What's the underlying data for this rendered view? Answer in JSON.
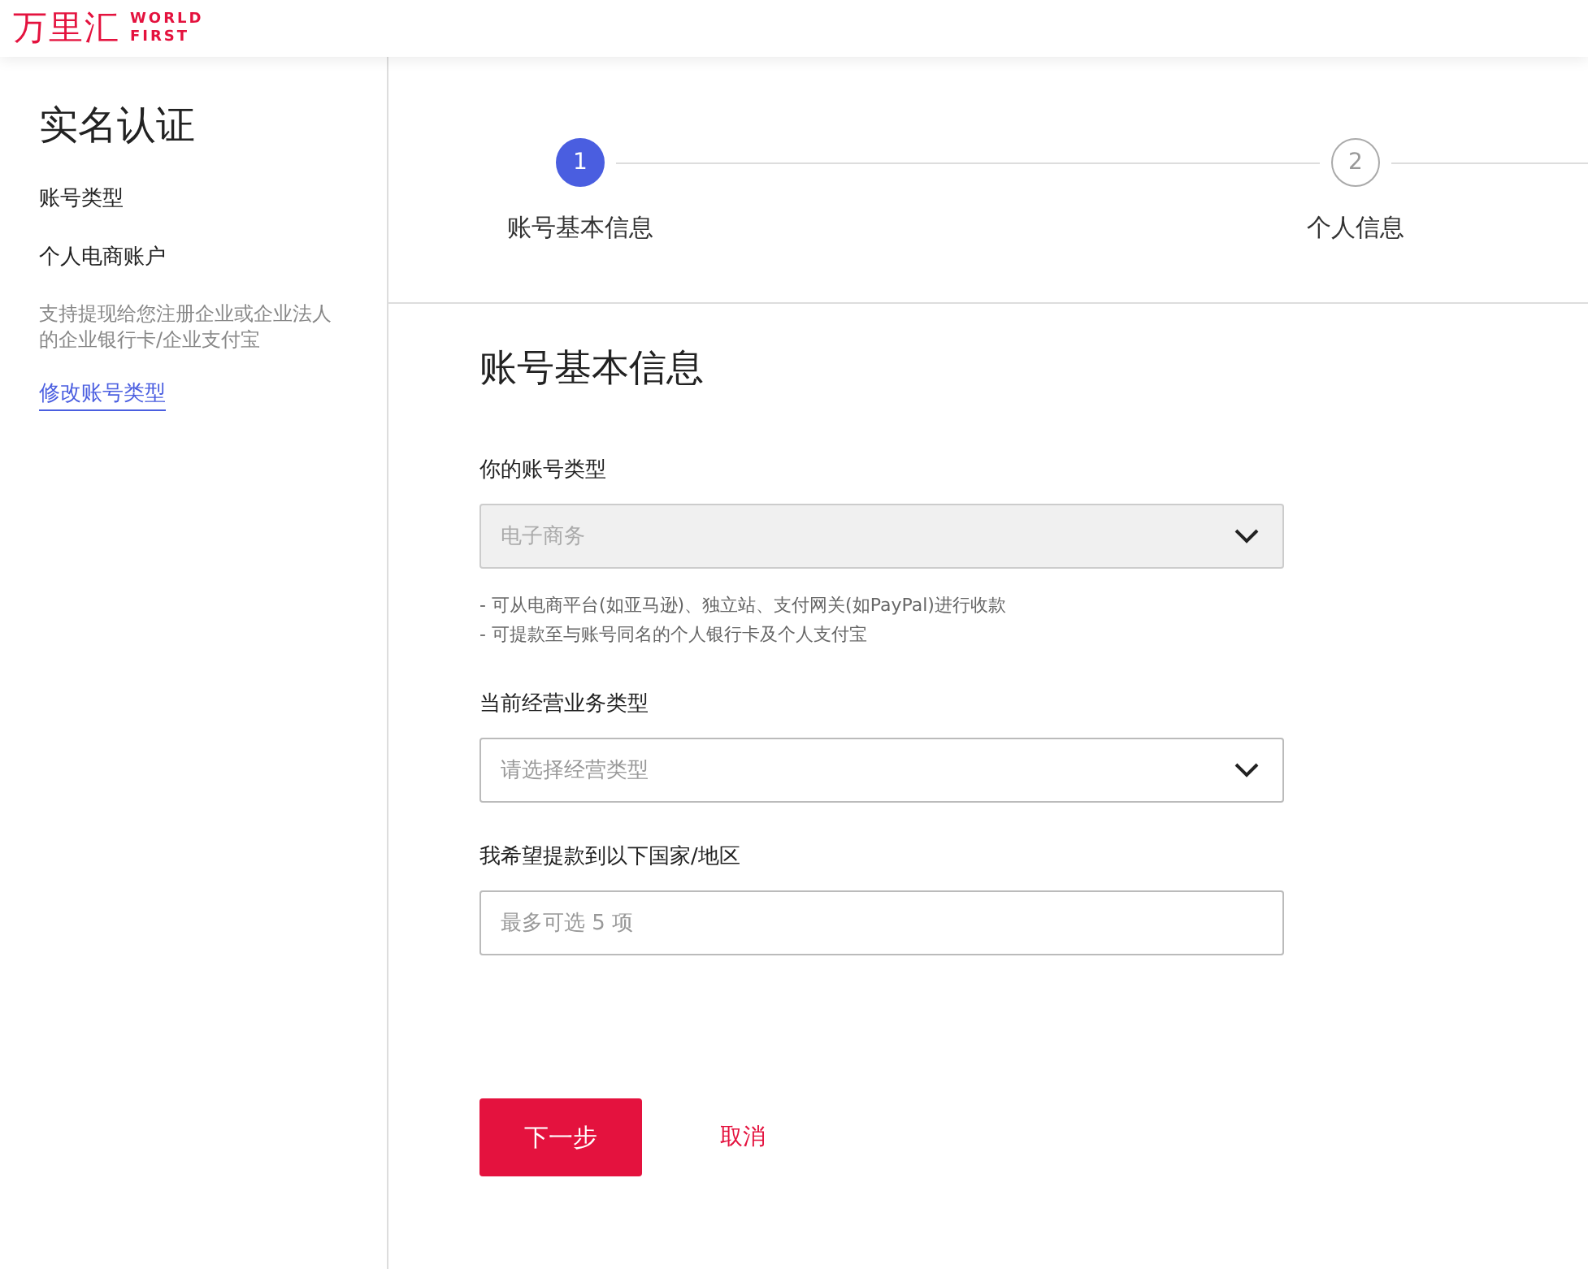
{
  "header": {
    "logo_cn": "万里汇",
    "logo_en_1": "WORLD",
    "logo_en_2": "FIRST"
  },
  "sidebar": {
    "title": "实名认证",
    "section_label": "账号类型",
    "account_type": "个人电商账户",
    "description": "支持提现给您注册企业或企业法人的企业银行卡/企业支付宝",
    "link": "修改账号类型"
  },
  "steps": [
    {
      "number": "1",
      "label": "账号基本信息",
      "selected": true
    },
    {
      "number": "2",
      "label": "个人信息",
      "selected": false
    }
  ],
  "form": {
    "title": "账号基本信息",
    "fields": [
      {
        "kind": "select",
        "label": "你的账号类型",
        "value": "电子商务",
        "disabled": true,
        "hints": [
          "- 可从电商平台(如亚马逊)、独立站、支付网关(如PayPal)进行收款",
          "- 可提款至与账号同名的个人银行卡及个人支付宝"
        ]
      },
      {
        "kind": "select",
        "label": "当前经营业务类型",
        "placeholder": "请选择经营类型",
        "disabled": false
      },
      {
        "kind": "input",
        "label": "我希望提款到以下国家/地区",
        "placeholder": "最多可选 5 项"
      }
    ]
  },
  "buttons": {
    "next": "下一步",
    "cancel": "取消"
  }
}
